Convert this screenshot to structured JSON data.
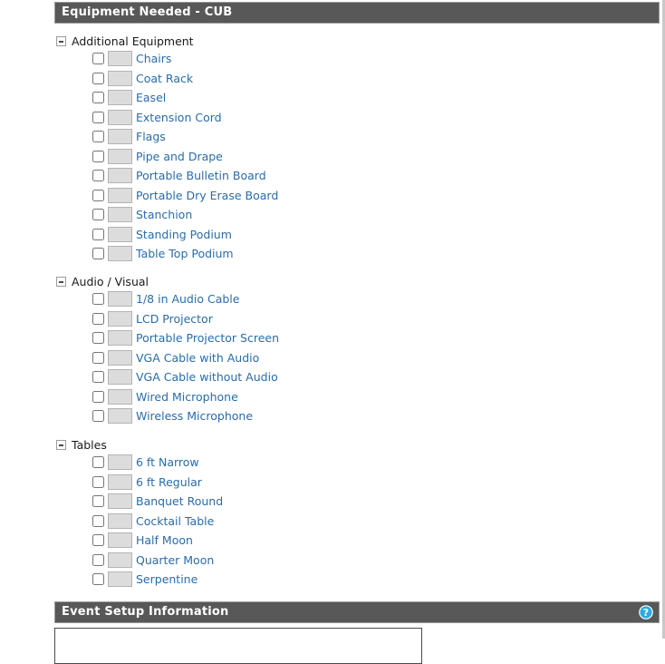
{
  "page": {
    "background_color": "#ffffff",
    "divider_color": "#c8c8c8"
  },
  "equipment_panel": {
    "header_title": "Equipment Needed - CUB",
    "header_bg": "#585858",
    "header_text_color": "#ffffff",
    "link_color": "#2a6ca8",
    "qty_box_bg": "#dcdcdc",
    "groups": [
      {
        "label": "Additional Equipment",
        "toggle_icon": "minus-square-icon",
        "expanded": true,
        "items": [
          {
            "label": "Chairs",
            "checked": false,
            "quantity": ""
          },
          {
            "label": "Coat Rack",
            "checked": false,
            "quantity": ""
          },
          {
            "label": "Easel",
            "checked": false,
            "quantity": ""
          },
          {
            "label": "Extension Cord",
            "checked": false,
            "quantity": ""
          },
          {
            "label": "Flags",
            "checked": false,
            "quantity": ""
          },
          {
            "label": "Pipe and Drape",
            "checked": false,
            "quantity": ""
          },
          {
            "label": "Portable Bulletin Board",
            "checked": false,
            "quantity": ""
          },
          {
            "label": "Portable Dry Erase Board",
            "checked": false,
            "quantity": ""
          },
          {
            "label": "Stanchion",
            "checked": false,
            "quantity": ""
          },
          {
            "label": "Standing Podium",
            "checked": false,
            "quantity": ""
          },
          {
            "label": "Table Top Podium",
            "checked": false,
            "quantity": ""
          }
        ]
      },
      {
        "label": "Audio / Visual",
        "toggle_icon": "minus-square-icon",
        "expanded": true,
        "items": [
          {
            "label": "1/8 in Audio Cable",
            "checked": false,
            "quantity": ""
          },
          {
            "label": "LCD Projector",
            "checked": false,
            "quantity": ""
          },
          {
            "label": "Portable Projector Screen",
            "checked": false,
            "quantity": ""
          },
          {
            "label": "VGA Cable with Audio",
            "checked": false,
            "quantity": ""
          },
          {
            "label": "VGA Cable without Audio",
            "checked": false,
            "quantity": ""
          },
          {
            "label": "Wired Microphone",
            "checked": false,
            "quantity": ""
          },
          {
            "label": "Wireless Microphone",
            "checked": false,
            "quantity": ""
          }
        ]
      },
      {
        "label": "Tables",
        "toggle_icon": "minus-square-icon",
        "expanded": true,
        "items": [
          {
            "label": "6 ft Narrow",
            "checked": false,
            "quantity": ""
          },
          {
            "label": "6 ft Regular",
            "checked": false,
            "quantity": ""
          },
          {
            "label": "Banquet Round",
            "checked": false,
            "quantity": ""
          },
          {
            "label": "Cocktail Table",
            "checked": false,
            "quantity": ""
          },
          {
            "label": "Half Moon",
            "checked": false,
            "quantity": ""
          },
          {
            "label": "Quarter Moon",
            "checked": false,
            "quantity": ""
          },
          {
            "label": "Serpentine",
            "checked": false,
            "quantity": ""
          }
        ]
      }
    ]
  },
  "event_setup_panel": {
    "header_title": "Event Setup Information",
    "help_icon": "help-circle-icon",
    "help_icon_color": "#29ABE2",
    "notes_value": "",
    "notes_placeholder": ""
  }
}
